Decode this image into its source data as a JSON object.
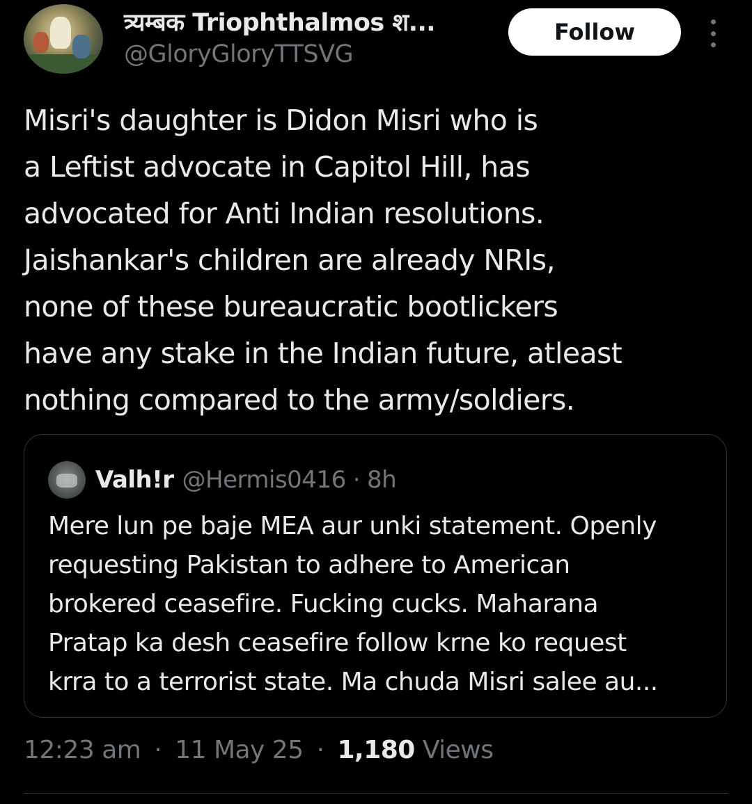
{
  "author": {
    "display_name": "त्र्यम्बक Triophthalmos श...",
    "handle": "@GloryGloryTTSVG"
  },
  "follow_button": {
    "label": "Follow"
  },
  "more_button": {
    "icon": "more-vertical-icon"
  },
  "tweet": {
    "lines": [
      "Misri's daughter is Didon Misri who is",
      "a Leftist advocate in Capitol Hill, has",
      "advocated for Anti Indian resolutions.",
      "Jaishankar's children are already NRIs,",
      "none of these bureaucratic bootlickers",
      "have any stake in the Indian future, atleast",
      "nothing compared to the army/soldiers."
    ]
  },
  "quoted_tweet": {
    "author_name": "Valh!r",
    "handle": "@Hermis0416",
    "dot": "·",
    "time": "8h",
    "lines": [
      "Mere lun pe baje MEA aur unki statement. Openly",
      "requesting Pakistan to adhere to American",
      "brokered ceasefire. Fucking cucks. Maharana",
      "Pratap ka desh ceasefire follow krne ko request",
      "krra to a terrorist state. Ma chuda Misri salee au..."
    ]
  },
  "meta": {
    "time": "12:23 am",
    "sep1": "·",
    "date": "11 May 25",
    "sep2": "·",
    "views_count": "1,180",
    "views_label": "Views"
  },
  "colors": {
    "background": "#000000",
    "text_primary": "#e7e9ea",
    "text_secondary": "#71767b",
    "border": "#2f3336",
    "follow_bg": "#ffffff"
  }
}
